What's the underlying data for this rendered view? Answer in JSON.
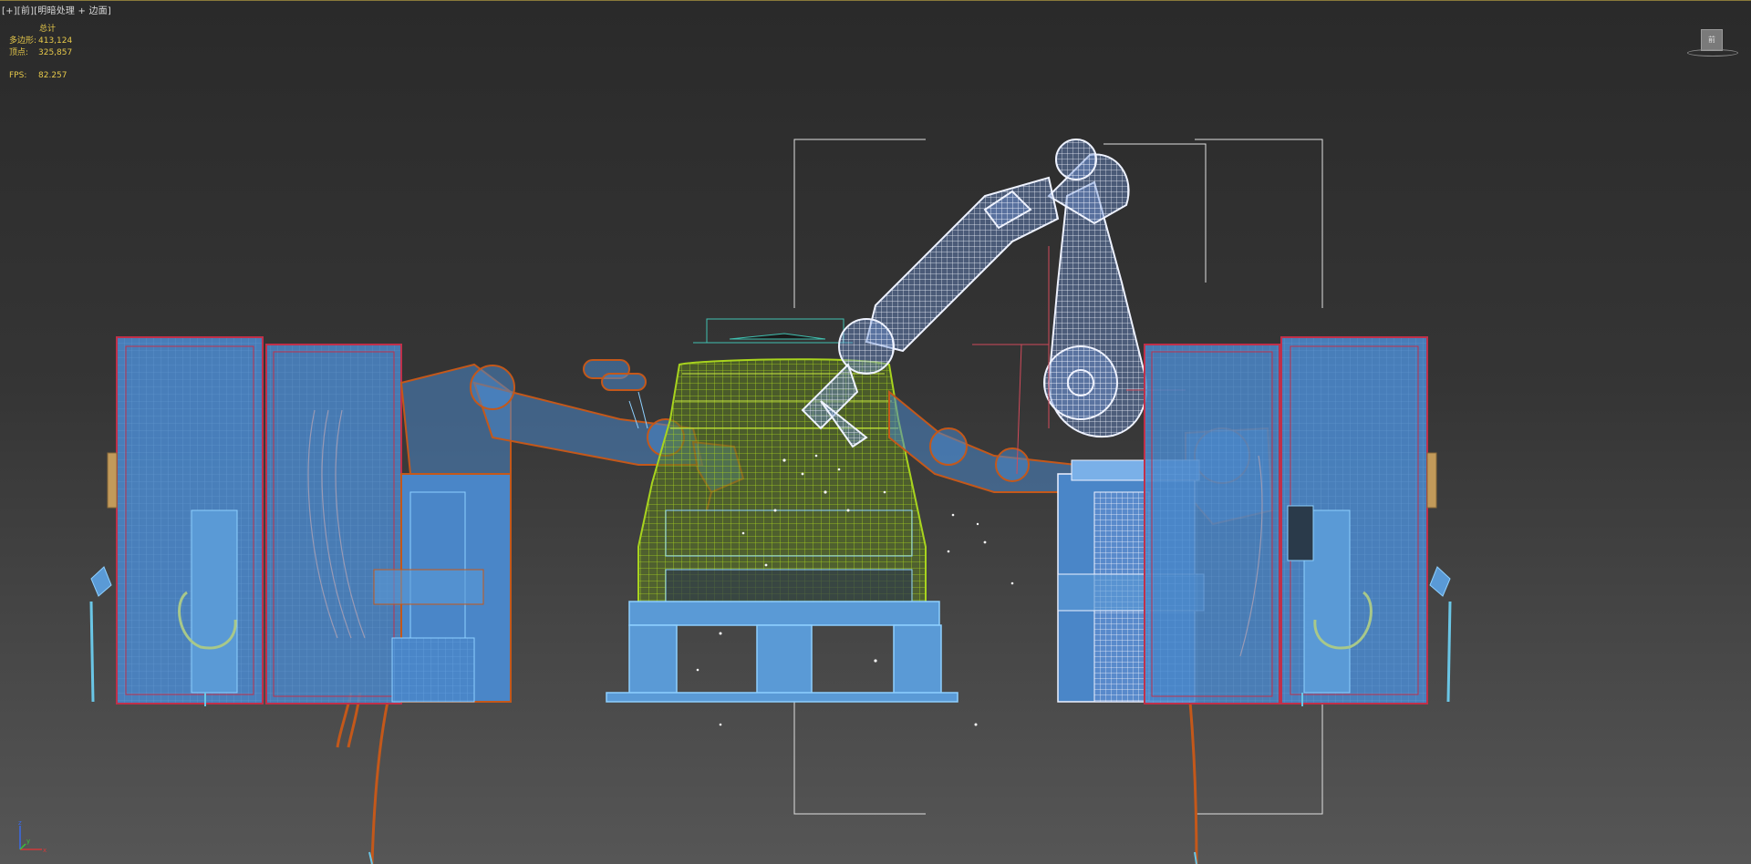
{
  "viewport": {
    "label_open": "[",
    "label_plus": "+",
    "label_mid": "][",
    "label_view": "前",
    "label_shading": "][明暗处理 + 边面]"
  },
  "stats": {
    "header": "总计",
    "polys_label": "多边形:",
    "polys_value": "413,124",
    "verts_label": "顶点:",
    "verts_value": "325,857",
    "fps_label": "FPS:",
    "fps_value": "82.257"
  },
  "viewcube": {
    "face_label": "前",
    "icon": "viewcube-icon"
  },
  "axis_gizmo": {
    "x": "x",
    "y": "y",
    "z": "z"
  },
  "colors": {
    "stats_text": "#e6c84a",
    "cabinet_fill": "#4a86c8",
    "cabinet_edge": "#c0304a",
    "orange_robot": "#c4581a",
    "white_robot": "#eef2ff",
    "car_wire": "#9bc21a",
    "platform": "#5a9ad6"
  }
}
